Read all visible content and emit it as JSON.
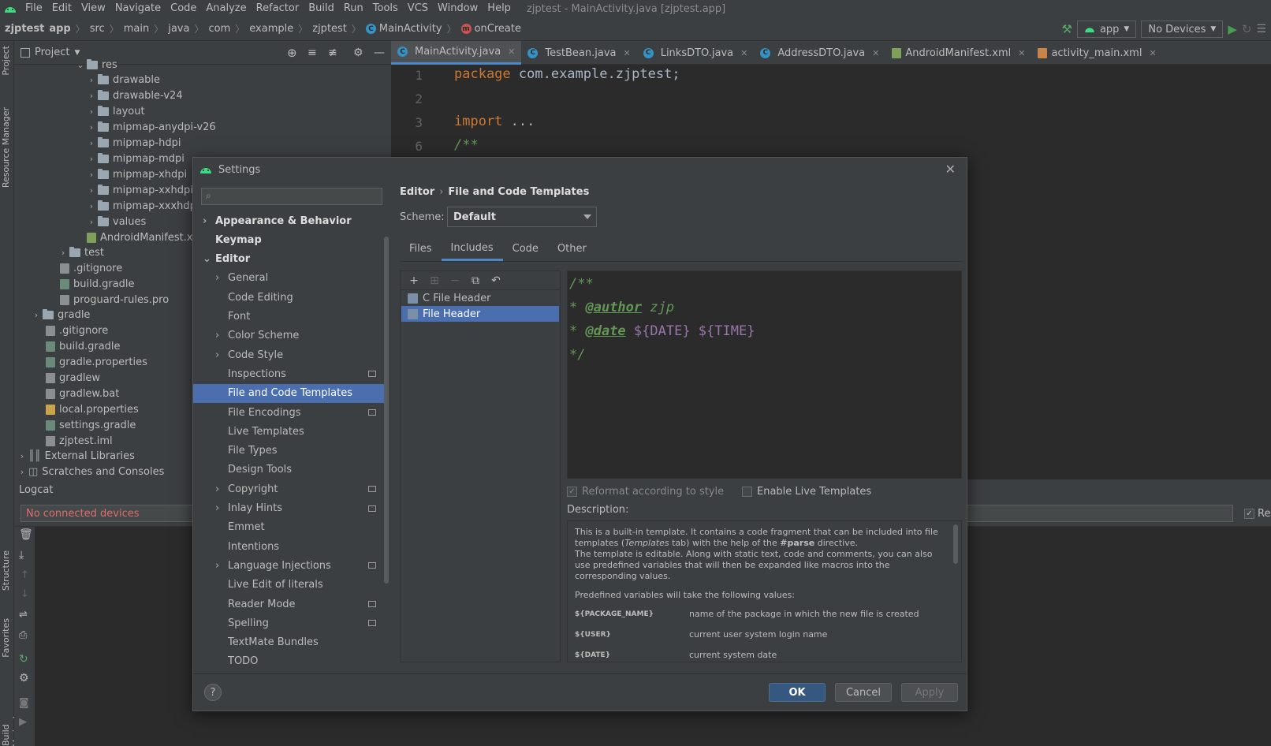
{
  "menubar": {
    "items": [
      "File",
      "Edit",
      "View",
      "Navigate",
      "Code",
      "Analyze",
      "Refactor",
      "Build",
      "Run",
      "Tools",
      "VCS",
      "Window",
      "Help"
    ],
    "window_title": "zjptest - MainActivity.java [zjptest.app]"
  },
  "navbar": {
    "breadcrumbs": [
      "zjptest",
      "app",
      "src",
      "main",
      "java",
      "com",
      "example",
      "zjptest",
      "MainActivity",
      "onCreate"
    ],
    "run_config": "app",
    "device": "No Devices"
  },
  "side_stripe": {
    "project": "Project",
    "resource_manager": "Resource Manager",
    "structure": "Structure",
    "favorites": "Favorites",
    "build_variants": "Build Variants"
  },
  "project_panel": {
    "title": "Project",
    "tree": [
      {
        "label": "res",
        "type": "folder",
        "expanded": true
      },
      {
        "label": "drawable",
        "type": "folder"
      },
      {
        "label": "drawable-v24",
        "type": "folder"
      },
      {
        "label": "layout",
        "type": "folder"
      },
      {
        "label": "mipmap-anydpi-v26",
        "type": "folder"
      },
      {
        "label": "mipmap-hdpi",
        "type": "folder"
      },
      {
        "label": "mipmap-mdpi",
        "type": "folder"
      },
      {
        "label": "mipmap-xhdpi",
        "type": "folder"
      },
      {
        "label": "mipmap-xxhdpi",
        "type": "folder"
      },
      {
        "label": "mipmap-xxxhdpi",
        "type": "folder"
      },
      {
        "label": "values",
        "type": "folder"
      },
      {
        "label": "AndroidManifest.xml",
        "type": "file"
      },
      {
        "label": "test",
        "type": "folder"
      },
      {
        "label": ".gitignore",
        "type": "file"
      },
      {
        "label": "build.gradle",
        "type": "file"
      },
      {
        "label": "proguard-rules.pro",
        "type": "file"
      },
      {
        "label": "gradle",
        "type": "folder"
      },
      {
        "label": ".gitignore",
        "type": "file"
      },
      {
        "label": "build.gradle",
        "type": "file"
      },
      {
        "label": "gradle.properties",
        "type": "file"
      },
      {
        "label": "gradlew",
        "type": "file"
      },
      {
        "label": "gradlew.bat",
        "type": "file"
      },
      {
        "label": "local.properties",
        "type": "file"
      },
      {
        "label": "settings.gradle",
        "type": "file"
      },
      {
        "label": "zjptest.iml",
        "type": "file"
      },
      {
        "label": "External Libraries",
        "type": "lib"
      },
      {
        "label": "Scratches and Consoles",
        "type": "lib"
      }
    ]
  },
  "editor_tabs": [
    "MainActivity.java",
    "TestBean.java",
    "LinksDTO.java",
    "AddressDTO.java",
    "AndroidManifest.xml",
    "activity_main.xml"
  ],
  "editor": {
    "lines": [
      {
        "num": "1",
        "keyword": "package",
        "text": " com.example.zjptest;"
      },
      {
        "num": "2",
        "keyword": "",
        "text": ""
      },
      {
        "num": "3",
        "keyword": "import",
        "text": " ..."
      },
      {
        "num": "6",
        "keyword": "",
        "text": "/**"
      }
    ]
  },
  "logcat": {
    "title": "Logcat",
    "device": "No connected devices",
    "regex_label": "Re"
  },
  "settings": {
    "title": "Settings",
    "search_placeholder": "",
    "nav": [
      {
        "label": "Appearance & Behavior",
        "level": 0,
        "arrow": "right",
        "bold": true
      },
      {
        "label": "Keymap",
        "level": 0,
        "arrow": "",
        "bold": true
      },
      {
        "label": "Editor",
        "level": 0,
        "arrow": "down",
        "bold": true
      },
      {
        "label": "General",
        "level": 1,
        "arrow": "right"
      },
      {
        "label": "Code Editing",
        "level": 1,
        "arrow": ""
      },
      {
        "label": "Font",
        "level": 1,
        "arrow": ""
      },
      {
        "label": "Color Scheme",
        "level": 1,
        "arrow": "right"
      },
      {
        "label": "Code Style",
        "level": 1,
        "arrow": "right"
      },
      {
        "label": "Inspections",
        "level": 1,
        "arrow": "",
        "project": true
      },
      {
        "label": "File and Code Templates",
        "level": 1,
        "arrow": "",
        "selected": true
      },
      {
        "label": "File Encodings",
        "level": 1,
        "arrow": "",
        "project": true
      },
      {
        "label": "Live Templates",
        "level": 1,
        "arrow": ""
      },
      {
        "label": "File Types",
        "level": 1,
        "arrow": ""
      },
      {
        "label": "Design Tools",
        "level": 1,
        "arrow": ""
      },
      {
        "label": "Copyright",
        "level": 1,
        "arrow": "right",
        "project": true
      },
      {
        "label": "Inlay Hints",
        "level": 1,
        "arrow": "right",
        "project": true
      },
      {
        "label": "Emmet",
        "level": 1,
        "arrow": ""
      },
      {
        "label": "Intentions",
        "level": 1,
        "arrow": ""
      },
      {
        "label": "Language Injections",
        "level": 1,
        "arrow": "right",
        "project": true
      },
      {
        "label": "Live Edit of literals",
        "level": 1,
        "arrow": ""
      },
      {
        "label": "Reader Mode",
        "level": 1,
        "arrow": "",
        "project": true
      },
      {
        "label": "Spelling",
        "level": 1,
        "arrow": "",
        "project": true
      },
      {
        "label": "TextMate Bundles",
        "level": 1,
        "arrow": ""
      },
      {
        "label": "TODO",
        "level": 1,
        "arrow": ""
      }
    ],
    "breadcrumb": [
      "Editor",
      "File and Code Templates"
    ],
    "scheme_label": "Scheme:",
    "scheme_value": "Default",
    "tabs": [
      "Files",
      "Includes",
      "Code",
      "Other"
    ],
    "active_tab": "Includes",
    "templates": [
      {
        "label": "C File Header",
        "selected": false
      },
      {
        "label": "File Header",
        "selected": true
      }
    ],
    "template_text": {
      "l1": "/**",
      "l2_prefix": "* ",
      "l2_tag": "@author",
      "l2_rest": " zjp",
      "l3_prefix": "* ",
      "l3_tag": "@date",
      "l3_v1": " ${DATE}",
      "l3_v2": " ${TIME}",
      "l4": "*/"
    },
    "reformat_label": "Reformat according to style",
    "reformat_checked": true,
    "live_templates_label": "Enable Live Templates",
    "live_templates_checked": false,
    "description_label": "Description:",
    "description": {
      "p1_a": "This is a built-in template. It contains a code fragment that can be included into file templates (",
      "p1_em": "Templates",
      "p1_b": " tab) with the help of the ",
      "p1_strong": "#parse",
      "p1_c": " directive.",
      "p2": "The template is editable. Along with static text, code and comments, you can also use predefined variables that will then be expanded like macros into the corresponding values.",
      "p3": "Predefined variables will take the following values:",
      "vars": [
        {
          "name": "${PACKAGE_NAME}",
          "desc": "name of the package in which the new file is created"
        },
        {
          "name": "${USER}",
          "desc": "current user system login name"
        },
        {
          "name": "${DATE}",
          "desc": "current system date"
        }
      ]
    },
    "buttons": {
      "ok": "OK",
      "cancel": "Cancel",
      "apply": "Apply",
      "help": "?"
    }
  }
}
